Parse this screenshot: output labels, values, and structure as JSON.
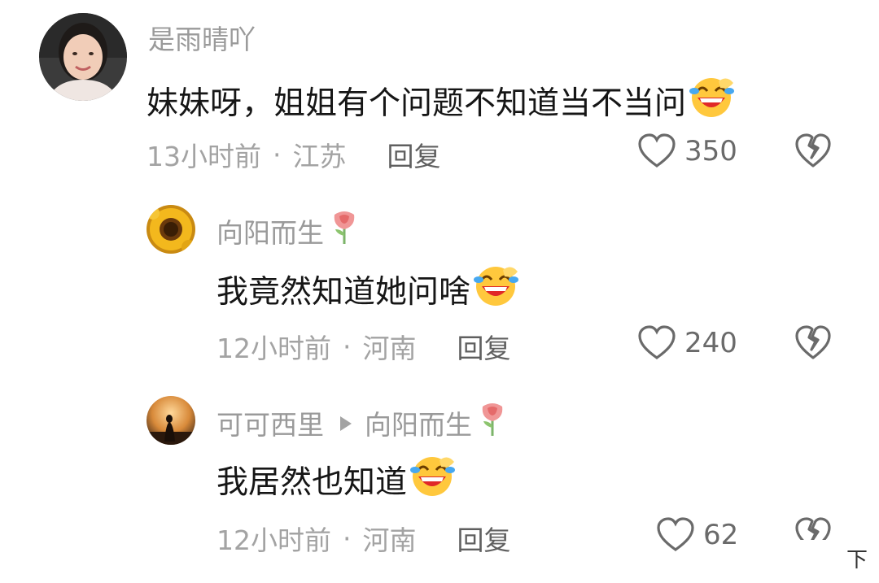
{
  "comments": [
    {
      "username": "是雨晴吖",
      "text": "妹妹呀，姐姐有个问题不知道当不当问",
      "time": "13小时前",
      "location": "江苏",
      "reply_label": "回复",
      "likes": "350",
      "avatar_icon": "woman-portrait-avatar",
      "emoji": "laughing-crying-emoji"
    },
    {
      "username": "向阳而生",
      "text": "我竟然知道她问啥",
      "time": "12小时前",
      "location": "河南",
      "reply_label": "回复",
      "likes": "240",
      "avatar_icon": "sunflower-avatar",
      "emoji": "laughing-crying-emoji",
      "badge_icon": "rose-icon"
    },
    {
      "username": "可可西里",
      "reply_to": "向阳而生",
      "text": "我居然也知道",
      "time": "12小时前",
      "location": "河南",
      "reply_label": "回复",
      "likes": "62",
      "avatar_icon": "sunset-silhouette-avatar",
      "emoji": "laughing-crying-emoji",
      "badge_icon": "rose-icon"
    }
  ],
  "footer": {
    "partial_label": "下"
  },
  "colors": {
    "username": "#9a9a9a",
    "text": "#161616",
    "meta": "#a3a3a3",
    "reply": "#5f5f5f",
    "icon": "#6a6a6a"
  }
}
